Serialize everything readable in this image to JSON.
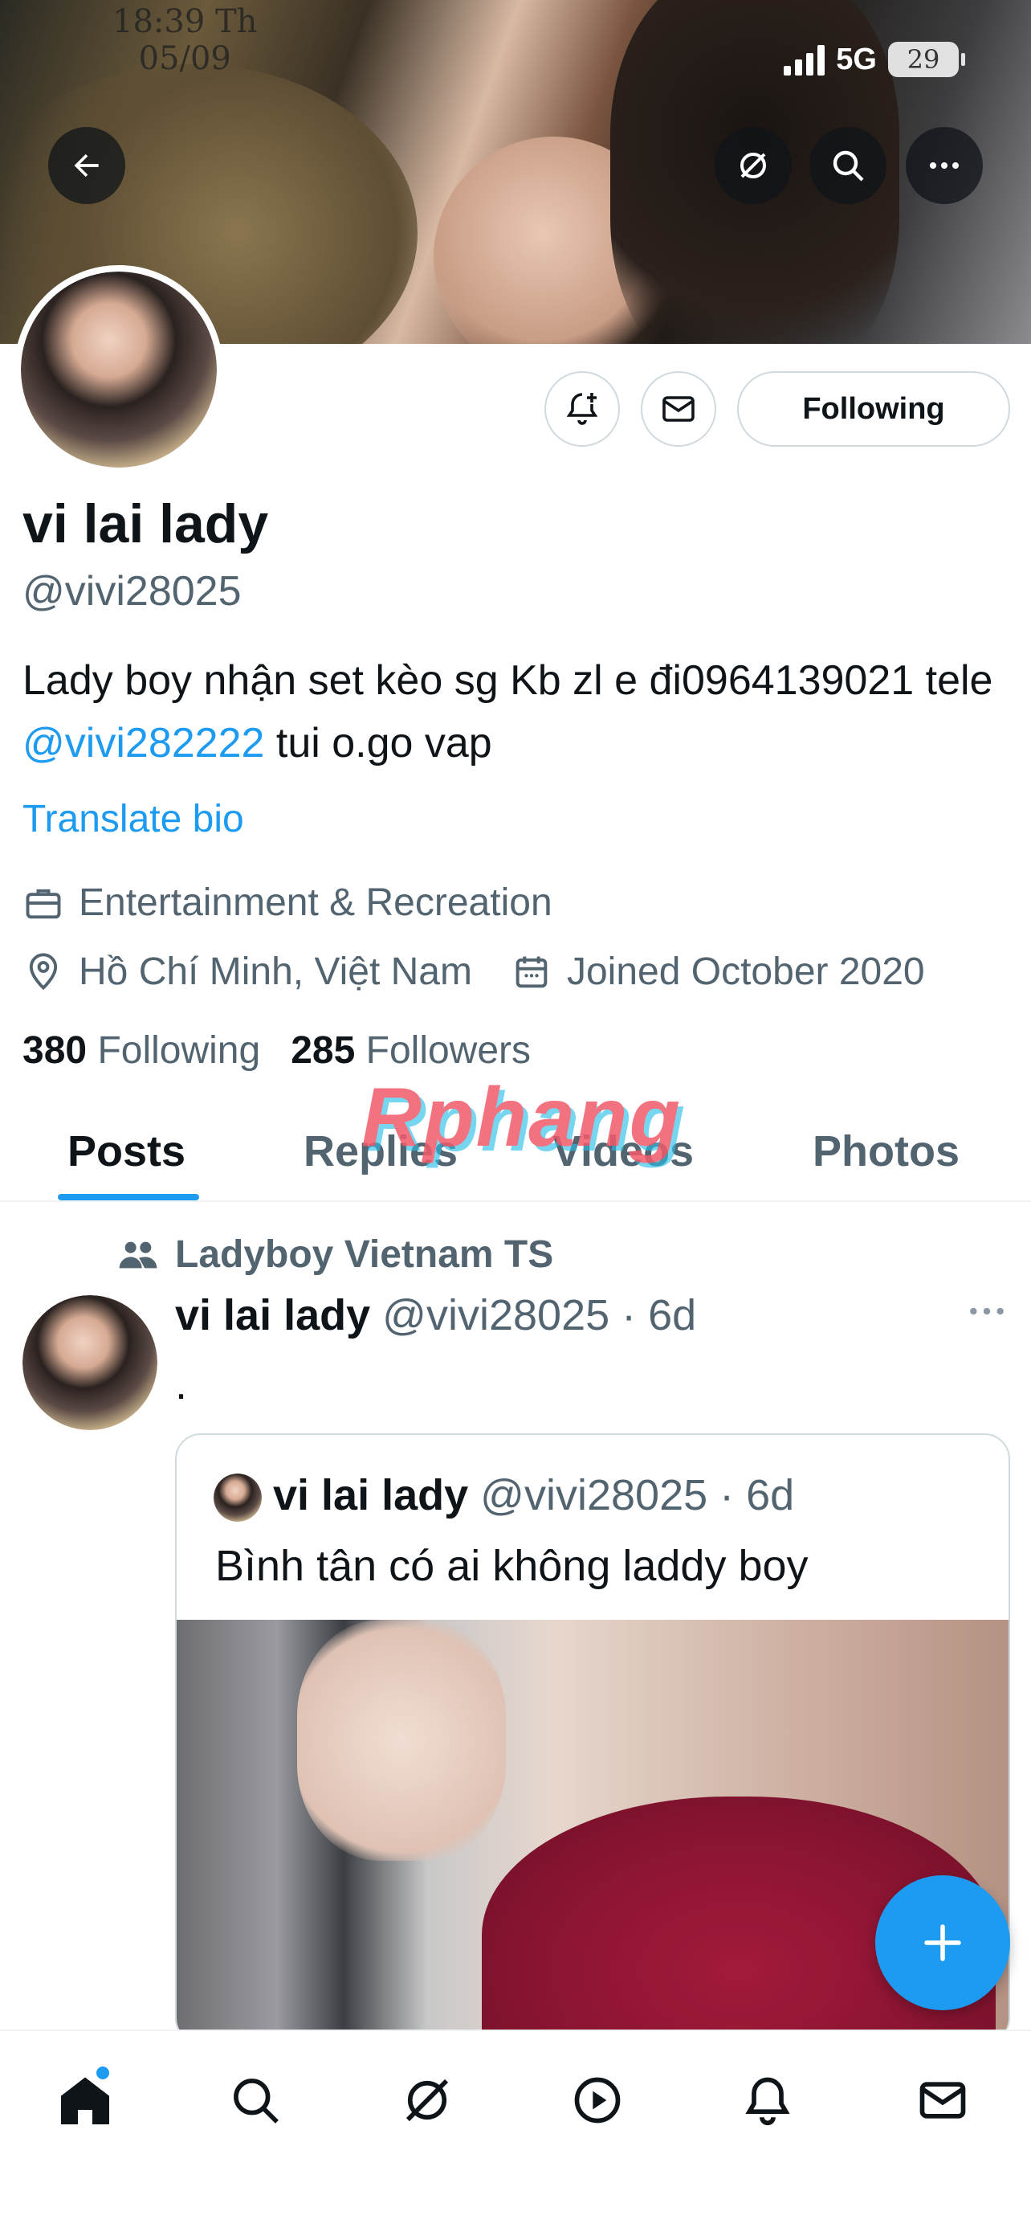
{
  "status_bar": {
    "time": "18:39 Th",
    "date": "05/09",
    "network": "5G",
    "battery": "29"
  },
  "profile": {
    "display_name": "vi lai lady",
    "handle": "@vivi28025",
    "bio_text": "Lady boy nhận set kèo sg Kb zl e đi0964139021 tele ",
    "bio_mention": "@vivi282222",
    "bio_suffix": " tui o.go vap",
    "translate_label": "Translate bio",
    "category": "Entertainment & Recreation",
    "location": "Hồ Chí Minh, Việt Nam",
    "joined": "Joined October 2020",
    "following_count": "380",
    "following_label": "Following",
    "followers_count": "285",
    "followers_label": "Followers",
    "follow_button_label": "Following"
  },
  "watermark": "Rphang",
  "tabs": [
    {
      "label": "Posts",
      "active": true
    },
    {
      "label": "Replies",
      "active": false
    },
    {
      "label": "Videos",
      "active": false
    },
    {
      "label": "Photos",
      "active": false
    }
  ],
  "post": {
    "community": "Ladyboy Vietnam TS",
    "author_name": "vi lai lady",
    "author_handle": "@vivi28025",
    "separator": " · ",
    "age": "6d",
    "text": ".",
    "quote": {
      "author_name": "vi lai lady",
      "author_handle": "@vivi28025",
      "age": "6d",
      "text": "Bình tân có ai không laddy boy"
    }
  },
  "icons": {
    "back": "arrow-left-icon",
    "grok": "grok-icon",
    "search": "search-icon",
    "more": "more-horizontal-icon",
    "notify": "bell-plus-icon",
    "message": "envelope-icon",
    "compose": "plus-icon",
    "nav": [
      "home-icon",
      "search-icon",
      "grok-icon",
      "play-icon",
      "bell-icon",
      "envelope-icon"
    ]
  },
  "colors": {
    "accent": "#1d9bf0",
    "text_primary": "#0f1419",
    "text_secondary": "#536471",
    "border": "#cfd9de"
  }
}
